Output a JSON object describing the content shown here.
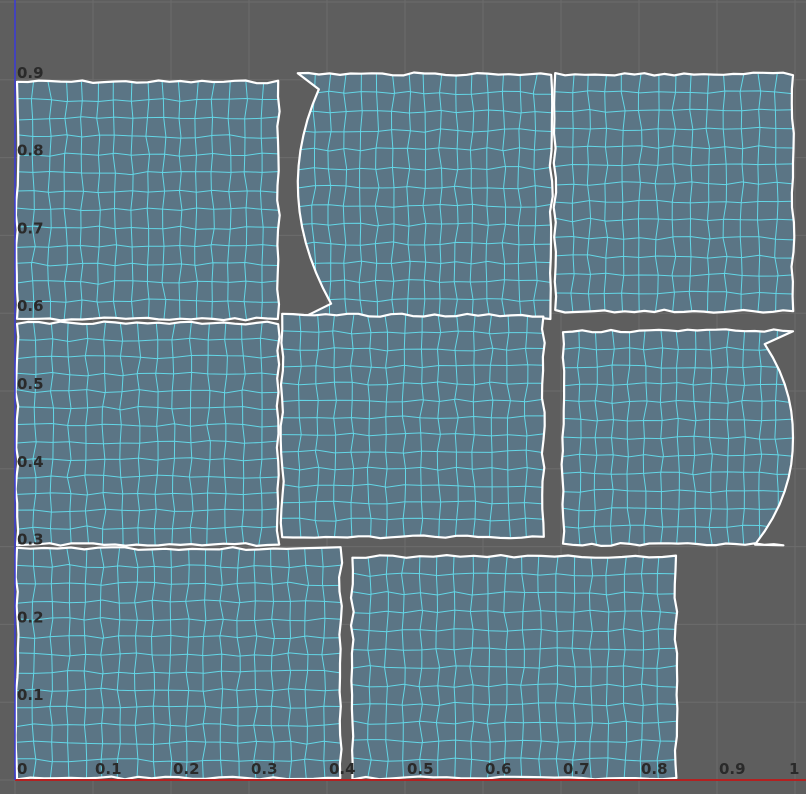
{
  "view": {
    "background": "#5e5e5e",
    "grid_color": "#6c6c6c",
    "u_axis_color": "#b42020",
    "v_axis_color": "#3a3ad8",
    "shell_fill": "#5b7585",
    "mesh_color": "#63d6e6",
    "outline_color": "#ffffff"
  },
  "axes": {
    "u_ticks": [
      "0",
      "0.1",
      "0.2",
      "0.3",
      "0.4",
      "0.5",
      "0.6",
      "0.7",
      "0.8",
      "0.9",
      "1"
    ],
    "v_ticks": [
      "0.1",
      "0.2",
      "0.3",
      "0.4",
      "0.5",
      "0.6",
      "0.7",
      "0.8",
      "0.9"
    ]
  },
  "uv_shells": [
    {
      "id": "shell-top-left",
      "u": [
        0.0,
        0.34
      ],
      "v": [
        0.59,
        0.9
      ],
      "rows": 13,
      "cols": 16
    },
    {
      "id": "shell-top-middle",
      "u": [
        0.36,
        0.69
      ],
      "v": [
        0.59,
        0.91
      ],
      "rows": 13,
      "cols": 16,
      "cut": "left"
    },
    {
      "id": "shell-top-right",
      "u": [
        0.69,
        1.0
      ],
      "v": [
        0.6,
        0.91
      ],
      "rows": 13,
      "cols": 14
    },
    {
      "id": "shell-mid-left",
      "u": [
        0.0,
        0.34
      ],
      "v": [
        0.3,
        0.59
      ],
      "rows": 13,
      "cols": 15
    },
    {
      "id": "shell-mid-middle",
      "u": [
        0.34,
        0.68
      ],
      "v": [
        0.31,
        0.6
      ],
      "rows": 13,
      "cols": 15
    },
    {
      "id": "shell-mid-right",
      "u": [
        0.7,
        1.0
      ],
      "v": [
        0.3,
        0.58
      ],
      "rows": 12,
      "cols": 14,
      "cut": "right"
    },
    {
      "id": "shell-bottom-left",
      "u": [
        0.0,
        0.42
      ],
      "v": [
        0.0,
        0.3
      ],
      "rows": 13,
      "cols": 19
    },
    {
      "id": "shell-bottom-right",
      "u": [
        0.43,
        0.85
      ],
      "v": [
        0.0,
        0.29
      ],
      "rows": 12,
      "cols": 19
    }
  ]
}
